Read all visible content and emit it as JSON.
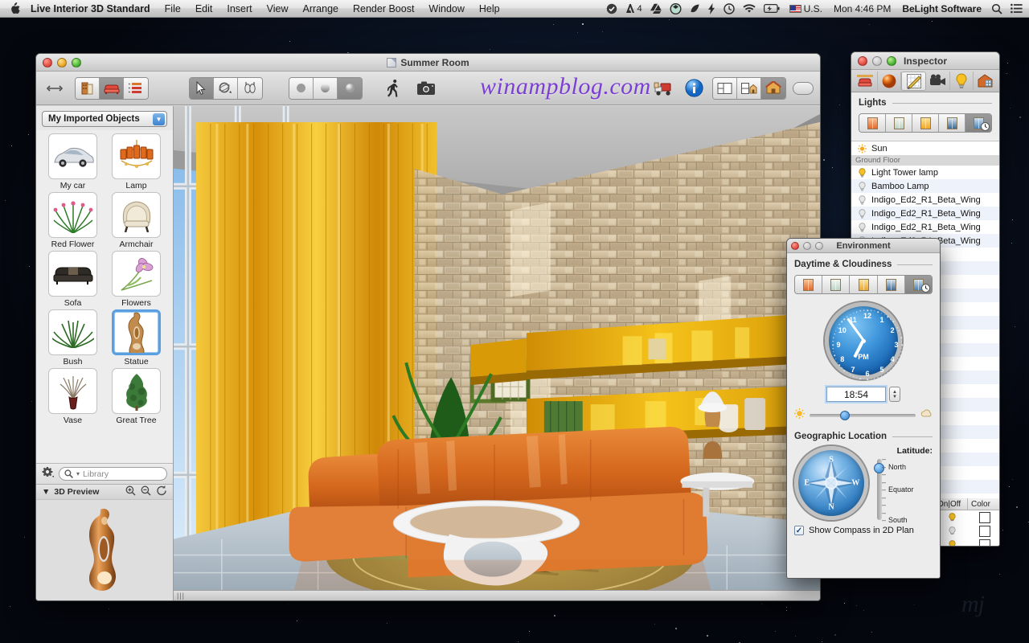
{
  "menubar": {
    "apple_icon": "apple-icon",
    "app_name": "Live Interior 3D Standard",
    "items": [
      "File",
      "Edit",
      "Insert",
      "View",
      "Arrange",
      "Render Boost",
      "Window",
      "Help"
    ],
    "status": {
      "icons": [
        "check-circle-icon",
        "adobe-icon",
        "google-drive-icon",
        "dropbox-icon",
        "evernote-icon",
        "flash-icon",
        "time-machine-icon",
        "wifi-icon",
        "battery-icon"
      ],
      "adobe_badge": "4",
      "input_source": "U.S.",
      "clock": "Mon 4:46 PM",
      "user": "BeLight Software",
      "search_icon": "search-icon",
      "notification_icon": "notification-center-icon"
    }
  },
  "window": {
    "title": "Summer Room",
    "watermark": "winampblog.com",
    "toolbar": {
      "resize_icon": "resize-arrows-icon",
      "mode_buttons": [
        {
          "name": "building-icon",
          "glyph": "🏢",
          "active": false
        },
        {
          "name": "furniture-icon",
          "glyph": "🪑",
          "active": true
        },
        {
          "name": "list-icon",
          "glyph": "☰",
          "active": false
        }
      ],
      "tool_buttons": [
        {
          "name": "select-arrow-icon",
          "active": true
        },
        {
          "name": "orbit-icon",
          "active": false
        },
        {
          "name": "walk-pan-icon",
          "active": false
        }
      ],
      "shading_buttons": [
        {
          "name": "flat-shading-icon",
          "active": false
        },
        {
          "name": "gradient-shading-icon",
          "active": false
        },
        {
          "name": "glossy-shading-icon",
          "active": true
        }
      ],
      "walk_icon": "walkthrough-icon",
      "camera_icon": "camera-icon",
      "render_icon": "render-truck-icon",
      "info_icon": "info-icon",
      "view_buttons": [
        {
          "name": "plan-view-icon",
          "active": false
        },
        {
          "name": "elevation-view-icon",
          "active": false
        },
        {
          "name": "3d-view-icon",
          "active": true
        }
      ],
      "minimize_pill": "toolbar-toggle-pill"
    },
    "statusbar": {
      "resize_grip": "resize-grip"
    }
  },
  "library": {
    "popup_label": "My Imported Objects",
    "popup_icon": "chevron-down-icon",
    "objects": [
      {
        "label": "My car",
        "icon": "car-thumbnail",
        "selected": false
      },
      {
        "label": "Lamp",
        "icon": "chandelier-thumbnail",
        "selected": false
      },
      {
        "label": "Red Flower",
        "icon": "red-flower-thumbnail",
        "selected": false
      },
      {
        "label": "Armchair",
        "icon": "armchair-thumbnail",
        "selected": false
      },
      {
        "label": "Sofa",
        "icon": "sofa-thumbnail",
        "selected": false
      },
      {
        "label": "Flowers",
        "icon": "flowers-thumbnail",
        "selected": false
      },
      {
        "label": "Bush",
        "icon": "bush-thumbnail",
        "selected": false
      },
      {
        "label": "Statue",
        "icon": "statue-thumbnail",
        "selected": true
      },
      {
        "label": "Vase",
        "icon": "vase-thumbnail",
        "selected": false
      },
      {
        "label": "Great Tree",
        "icon": "tree-thumbnail",
        "selected": false
      }
    ],
    "gear_icon": "gear-icon",
    "search_placeholder": "Library",
    "search_icon": "search-icon",
    "preview_title": "3D Preview",
    "preview_disclosure": "disclosure-triangle-icon",
    "preview_tools": [
      "zoom-in-icon",
      "zoom-out-icon",
      "rotate-icon"
    ],
    "preview_object": "statue-3d-preview"
  },
  "inspector": {
    "title": "Inspector",
    "tabs": [
      {
        "name": "object-tab-icon",
        "active": false
      },
      {
        "name": "material-tab-icon",
        "active": false
      },
      {
        "name": "edit-tab-icon",
        "active": true
      },
      {
        "name": "camera-tab-icon",
        "active": false
      },
      {
        "name": "light-tab-icon",
        "active": false
      },
      {
        "name": "building-tab-icon",
        "active": false
      }
    ],
    "section_title": "Lights",
    "presets": [
      {
        "name": "preset-sunset-icon",
        "active": false
      },
      {
        "name": "preset-daylight-icon",
        "active": false
      },
      {
        "name": "preset-warm-icon",
        "active": false
      },
      {
        "name": "preset-night-icon",
        "active": false
      },
      {
        "name": "preset-custom-icon",
        "active": true
      }
    ],
    "lights": [
      {
        "label": "Sun",
        "icon": "sun-icon",
        "type": "item"
      },
      {
        "label": "Ground Floor",
        "icon": "",
        "type": "group"
      },
      {
        "label": "Light Tower lamp",
        "icon": "bulb-on-icon",
        "type": "item"
      },
      {
        "label": "Bamboo Lamp",
        "icon": "bulb-off-icon",
        "type": "item"
      },
      {
        "label": "Indigo_Ed2_R1_Beta_Wing",
        "icon": "bulb-off-icon",
        "type": "item"
      },
      {
        "label": "Indigo_Ed2_R1_Beta_Wing",
        "icon": "bulb-off-icon",
        "type": "item"
      },
      {
        "label": "Indigo_Ed2_R1_Beta_Wing",
        "icon": "bulb-off-icon",
        "type": "item"
      },
      {
        "label": "Indigo_Ed2_R1_Beta_Wing",
        "icon": "bulb-off-icon",
        "type": "item"
      }
    ],
    "columns": [
      "On|Off",
      "Color"
    ],
    "column_rows": [
      {
        "on": "bulb-on-icon",
        "color": "#ffffff"
      },
      {
        "on": "bulb-off-icon",
        "color": "#ffffff"
      },
      {
        "on": "bulb-on-icon",
        "color": "#ffffff"
      }
    ]
  },
  "environment": {
    "title": "Environment",
    "daytime_title": "Daytime & Cloudiness",
    "presets": [
      {
        "name": "env-sunset-icon",
        "active": false
      },
      {
        "name": "env-daylight-icon",
        "active": false
      },
      {
        "name": "env-warm-icon",
        "active": false
      },
      {
        "name": "env-night-icon",
        "active": false
      },
      {
        "name": "env-custom-icon",
        "active": true
      }
    ],
    "clock": {
      "numbers": [
        "12",
        "1",
        "2",
        "3",
        "4",
        "5",
        "6",
        "7",
        "8",
        "9",
        "10",
        "11"
      ],
      "meridiem": "PM",
      "hour_angle": 207,
      "minute_angle": 324
    },
    "time_value": "18:54",
    "stepper_icon": "stepper-up-down-icon",
    "cloudiness": {
      "left_icon": "sun-small-icon",
      "right_icon": "cloud-small-icon",
      "value_pct": 33
    },
    "geo_title": "Geographic Location",
    "compass_icon": "compass-rose",
    "compass_dirs": [
      "N",
      "E",
      "S",
      "W"
    ],
    "latitude_label": "Latitude:",
    "latitude_ticks": [
      "North",
      "Equator",
      "South"
    ],
    "latitude_knob_pct": 14,
    "show_compass_label": "Show Compass in 2D Plan",
    "show_compass_checked": true,
    "check_icon": "checkmark-icon"
  },
  "desktop": {
    "watermark": "mj"
  },
  "colors": {
    "accent_blue": "#3f82cf",
    "selection_blue": "#5a9fe0",
    "watermark_purple": "#7b3fd4",
    "curtain_yellow": "#e8a716",
    "sofa_orange": "#d4671c",
    "stone_wall": "#cbb896"
  }
}
